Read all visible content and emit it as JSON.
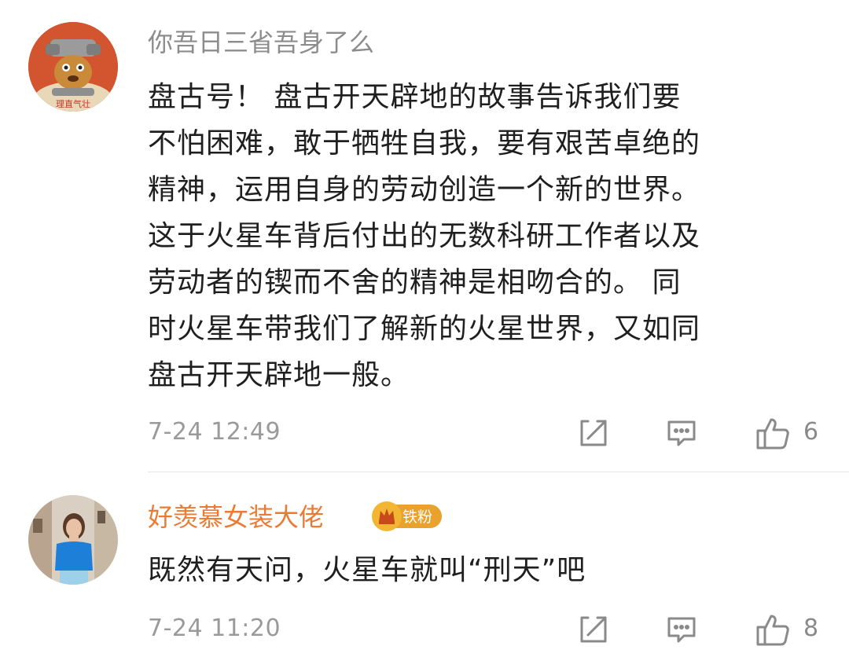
{
  "comments": [
    {
      "username": "你吾日三省吾身了么",
      "avatar_caption": "理直气壮",
      "lines": [
        "盘古号！ 盘古开天辟地的故事告诉我们要",
        "不怕困难，敢于牺牲自我，要有艰苦卓绝的",
        "精神，运用自身的劳动创造一个新的世界。",
        "这于火星车背后付出的无数科研工作者以及",
        "劳动者的锲而不舍的精神是相吻合的。 同",
        "时火星车带我们了解新的火星世界，又如同",
        "盘古开天辟地一般。"
      ],
      "timestamp": "7-24 12:49",
      "like_count": "6",
      "icons": [
        "share-icon",
        "reply-icon",
        "thumbs-up-icon"
      ]
    },
    {
      "username": "好羡慕女装大佬",
      "badge": "铁粉",
      "lines": [
        "既然有天问，火星车就叫“刑天”吧"
      ],
      "timestamp": "7-24 11:20",
      "like_count": "8",
      "icons": [
        "share-icon",
        "reply-icon",
        "thumbs-up-icon"
      ]
    }
  ],
  "colors": {
    "username_gray": "#8c8c8c",
    "username_orange": "#eb7b34",
    "badge_gold": "#e9a22c",
    "timestamp": "#9a9a9a",
    "icon": "#8a8a8a"
  }
}
